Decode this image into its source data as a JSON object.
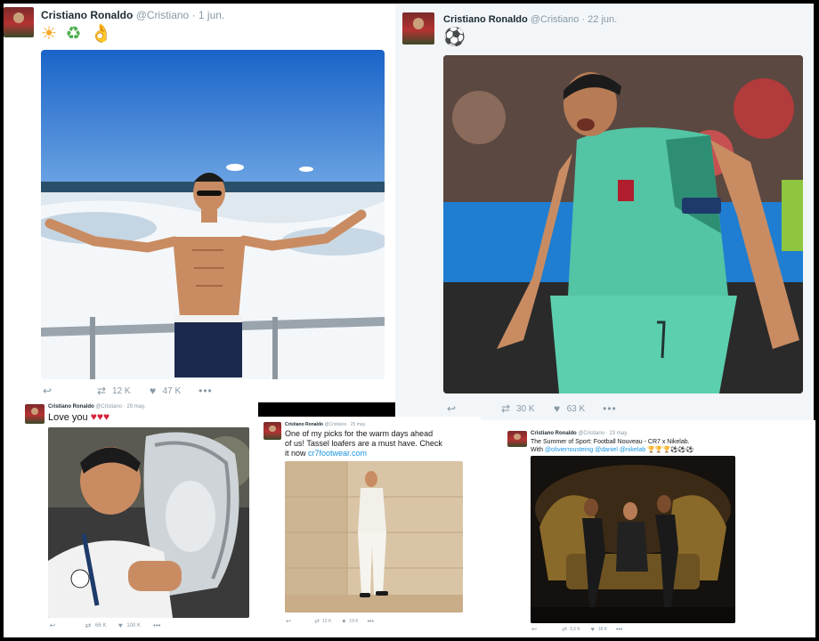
{
  "author": {
    "name": "Cristiano Ronaldo",
    "handle": "@Cristiano"
  },
  "icons": {
    "reply": "reply-arrow-icon",
    "retweet": "retweet-icon",
    "like": "heart-icon",
    "more": "more-dots-icon",
    "soccer": "soccer-ball-icon",
    "sun": "sun-icon",
    "recycle": "recycle-icon",
    "ok": "ok-hand-icon"
  },
  "tweets": [
    {
      "date": "1 jun.",
      "text": "☀️ ♻️ 👌",
      "retweets": "12 K",
      "likes": "47 K"
    },
    {
      "date": "22 jun.",
      "text": "⚽",
      "retweets": "30 K",
      "likes": "63 K"
    },
    {
      "date": "29 may.",
      "text": "Love you",
      "hearts": "♥♥♥",
      "retweets": "66 K",
      "likes": "100 K"
    },
    {
      "date": "25 may.",
      "text_line1": "One of my picks for the warm days ahead",
      "text_line2": "of us! Tassel loafers are a must have. Check",
      "text_line3_prefix": "it now",
      "link": "cr7footwear.com",
      "retweets": "12 K",
      "likes": "19 K"
    },
    {
      "date": "23 may.",
      "text_line1": "The Summer of Sport: Football Nouveau - CR7 x Nikelab.",
      "text_line2_prefix": "With",
      "mentions": "@olivierrousteing @daniel @nikelab",
      "trophies": "🏆🏆🏆⚽⚽⚽",
      "retweets": "3,3 K",
      "likes": "18 K"
    }
  ],
  "colors": {
    "link": "#1b95e0",
    "muted": "#8899a6",
    "text": "#14171a",
    "heart": "#d6213a"
  }
}
